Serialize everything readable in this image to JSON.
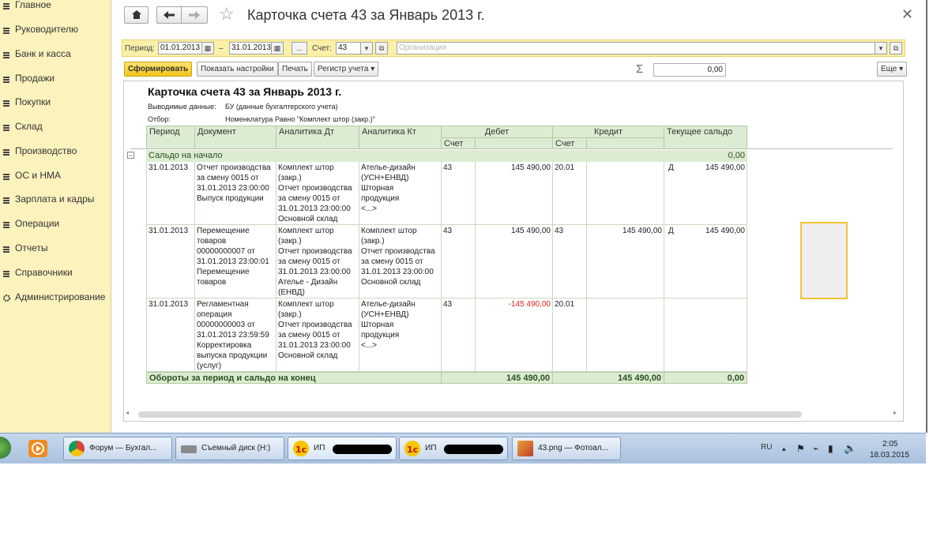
{
  "sidebar": {
    "items": [
      "Главное",
      "Руководителю",
      "Банк и касса",
      "Продажи",
      "Покупки",
      "Склад",
      "Производство",
      "ОС и НМА",
      "Зарплата и кадры",
      "Операции",
      "Отчеты",
      "Справочники",
      "Администрирование"
    ]
  },
  "header": {
    "title": "Карточка счета 43 за Январь 2013 г.",
    "home_icon": "home-icon",
    "back_icon": "arrow-left-icon",
    "forward_icon": "arrow-right-icon",
    "star_icon": "star-icon",
    "close_icon": "close-icon"
  },
  "params": {
    "period_label": "Период:",
    "date_from": "01.01.2013",
    "dash": "–",
    "date_to": "31.01.2013",
    "ellipsis": "...",
    "account_label": "Счет:",
    "account": "43",
    "org_placeholder": "Организация"
  },
  "actions": {
    "generate": "Сформировать",
    "settings": "Показать настройки",
    "print": "Печать",
    "register": "Регистр учета",
    "sum_symbol": "Σ",
    "sum_value": "0,00",
    "more": "Еще"
  },
  "report": {
    "title": "Карточка счета 43 за Январь 2013 г.",
    "output_label": "Выводимые данные:",
    "output_value": "БУ (данные бухгалтерского учета)",
    "filter_label": "Отбор:",
    "filter_value": "Номенклатура Равно \"Комплект штор (закр.)\"",
    "headers": {
      "period": "Период",
      "document": "Документ",
      "an_dt": "Аналитика Дт",
      "an_kt": "Аналитика Кт",
      "debit": "Дебет",
      "credit": "Кредит",
      "balance": "Текущее сальдо",
      "acct_dt": "Счет",
      "acct_kt": "Счет"
    },
    "opening": {
      "label": "Сальдо на начало",
      "value": "0,00"
    },
    "rows": [
      {
        "period": "31.01.2013",
        "document": "Отчет производства\nза смену 0015 от\n31.01.2013 23:00:00\nВыпуск продукции",
        "an_dt": "Комплект штор\n(закр.)\nОтчет производства\nза смену 0015 от\n31.01.2013 23:00:00\nОсновной склад",
        "an_kt": "Ателье-дизайн\n(УСН+ЕНВД)\nШторная\nпродукция\n<...>",
        "acct_dt": "43",
        "debit": "145 490,00",
        "acct_kt": "20.01",
        "credit": "",
        "bal_sign": "Д",
        "balance": "145 490,00"
      },
      {
        "period": "31.01.2013",
        "document": "Перемещение\nтоваров\n00000000007 от\n31.01.2013 23:00:01\nПеремещение\nтоваров",
        "an_dt": "Комплект штор\n(закр.)\nОтчет производства\nза смену 0015 от\n31.01.2013 23:00:00\nАтелье - Дизайн\n(ЕНВД)",
        "an_kt": "Комплект штор\n(закр.)\nОтчет производства\nза смену 0015 от\n31.01.2013 23:00:00\nОсновной склад",
        "acct_dt": "43",
        "debit": "145 490,00",
        "acct_kt": "43",
        "credit": "145 490,00",
        "bal_sign": "Д",
        "balance": "145 490,00"
      },
      {
        "period": "31.01.2013",
        "document": "Регламентная\nоперация\n00000000003 от\n31.01.2013 23:59:59\nКорректировка\nвыпуска продукции\n(услуг)",
        "an_dt": "Комплект штор\n(закр.)\nОтчет производства\nза смену 0015 от\n31.01.2013 23:00:00\nОсновной склад",
        "an_kt": "Ателье-дизайн\n(УСН+ЕНВД)\nШторная\nпродукция\n<...>",
        "acct_dt": "43",
        "debit": "-145 490,00",
        "acct_kt": "20.01",
        "credit": "",
        "bal_sign": "",
        "balance": ""
      }
    ],
    "totals": {
      "label": "Обороты за период и сальдо на конец",
      "debit": "145 490,00",
      "credit": "145 490,00",
      "balance": "0,00"
    },
    "negative_color": "#e02020"
  },
  "taskbar": {
    "items": [
      {
        "label": "Форум — Бухгал...",
        "icon": "chrome-icon"
      },
      {
        "label": "Съемный диск (H:)",
        "icon": "drive-icon"
      },
      {
        "label": "ИП",
        "icon": "1c-icon"
      },
      {
        "label": "ИП",
        "icon": "1c-icon"
      },
      {
        "label": "43.png — Фотоал...",
        "icon": "photo-icon"
      }
    ],
    "lang": "RU",
    "time": "2:05",
    "date": "18.03.2015"
  }
}
